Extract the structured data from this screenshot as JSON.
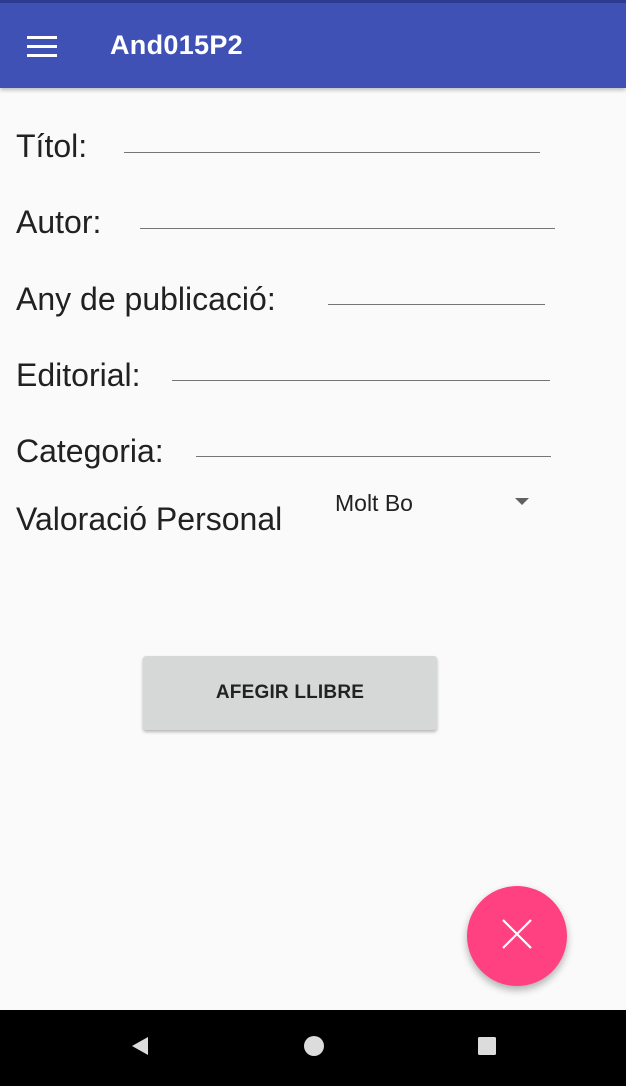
{
  "app_bar": {
    "title": "And015P2",
    "menu_icon": "hamburger-menu-icon",
    "color": "#3f51b5"
  },
  "form": {
    "title_label": "Títol:",
    "author_label": "Autor:",
    "year_label": "Any de publicació:",
    "publisher_label": "Editorial:",
    "category_label": "Categoria:",
    "rating_label": "Valoració Personal",
    "rating_value": "Molt Bo",
    "title_value": "",
    "author_value": "",
    "year_value": "",
    "publisher_value": "",
    "category_value": ""
  },
  "add_button": {
    "label": "AFEGIR LLIBRE"
  },
  "fab": {
    "icon": "close-icon",
    "color": "#ff4081"
  },
  "nav_bar": {
    "back_icon": "back-triangle-icon",
    "home_icon": "home-circle-icon",
    "recents_icon": "recents-square-icon"
  }
}
